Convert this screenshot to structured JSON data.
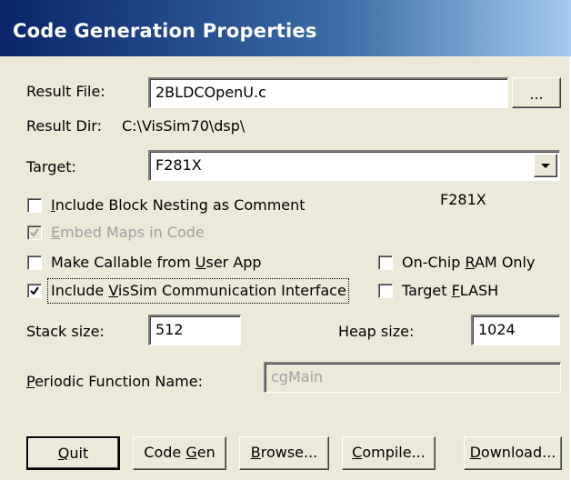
{
  "window": {
    "title": "Code Generation Properties"
  },
  "result_file": {
    "label": "Result File:",
    "value": "2BLDCOpenU.c",
    "browse_label": "..."
  },
  "result_dir": {
    "label": "Result Dir:",
    "value": "C:\\VisSim70\\dsp\\"
  },
  "target": {
    "label": "Target:",
    "value": "F281X",
    "info": "F281X",
    "dropdown_icon": "chevron-down-icon"
  },
  "options": {
    "include_block_nesting": {
      "label_u": "I",
      "label_rest": "nclude Block Nesting as Comment",
      "checked": false
    },
    "embed_maps": {
      "label_u": "E",
      "label_rest": "mbed Maps in Code",
      "checked": true,
      "disabled": true
    },
    "make_callable": {
      "label_pre": "Make Callable from ",
      "label_u": "U",
      "label_post": "ser App",
      "checked": false
    },
    "include_vissim_comm": {
      "label_pre": "Include ",
      "label_u": "V",
      "label_post": "isSim Communication Interface",
      "checked": true
    },
    "on_chip_ram": {
      "label_pre": "On-Chip ",
      "label_u": "R",
      "label_post": "AM Only",
      "checked": false
    },
    "target_flash": {
      "label_pre": "Target ",
      "label_u": "F",
      "label_post": "LASH",
      "checked": false
    }
  },
  "stack": {
    "label": "Stack size:",
    "value": "512"
  },
  "heap": {
    "label": "Heap size:",
    "value": "1024"
  },
  "periodic": {
    "label_u": "P",
    "label_rest": "eriodic Function Name:",
    "value": "cgMain"
  },
  "buttons": {
    "quit": {
      "u": "Q",
      "rest": "uit"
    },
    "codegen": {
      "pre": "Code ",
      "u": "G",
      "rest": "en"
    },
    "browse": {
      "u": "B",
      "rest": "rowse..."
    },
    "compile": {
      "u": "C",
      "rest": "ompile..."
    },
    "download": {
      "u": "D",
      "rest": "ownload..."
    }
  }
}
